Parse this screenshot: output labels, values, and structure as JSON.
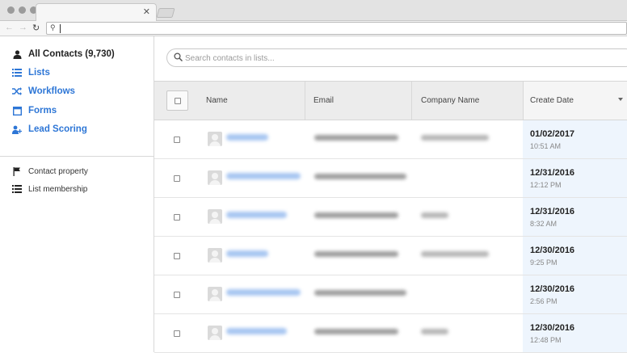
{
  "sidebar": {
    "nav": [
      {
        "label": "All Contacts (9,730)",
        "icon": "person-icon",
        "active": true
      },
      {
        "label": "Lists",
        "icon": "list-icon",
        "active": false
      },
      {
        "label": "Workflows",
        "icon": "shuffle-icon",
        "active": false
      },
      {
        "label": "Forms",
        "icon": "form-icon",
        "active": false
      },
      {
        "label": "Lead Scoring",
        "icon": "lead-scoring-icon",
        "active": false
      }
    ],
    "filters": [
      {
        "label": "Contact property",
        "icon": "flag-icon"
      },
      {
        "label": "List membership",
        "icon": "list-icon"
      }
    ]
  },
  "search": {
    "placeholder": "Search contacts in lists..."
  },
  "table": {
    "columns": [
      "Name",
      "Email",
      "Company Name",
      "Create Date"
    ],
    "sorted_column": "Create Date",
    "rows": [
      {
        "date": "01/02/2017",
        "time": "10:51 AM"
      },
      {
        "date": "12/31/2016",
        "time": "12:12 PM"
      },
      {
        "date": "12/31/2016",
        "time": "8:32 AM"
      },
      {
        "date": "12/30/2016",
        "time": "9:25 PM"
      },
      {
        "date": "12/30/2016",
        "time": "2:56 PM"
      },
      {
        "date": "12/30/2016",
        "time": "12:48 PM"
      }
    ]
  },
  "colors": {
    "accent": "#2d76d6",
    "sorted_column_bg": "#eef5fd",
    "header_bg": "#ececec"
  }
}
